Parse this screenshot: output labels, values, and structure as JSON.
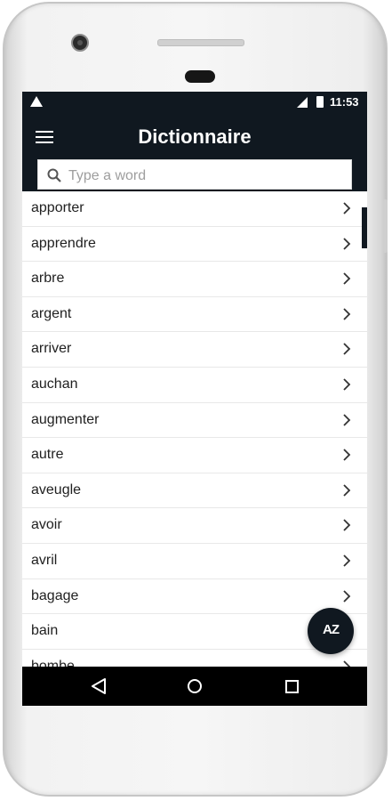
{
  "status_bar": {
    "time": "11:53"
  },
  "app_bar": {
    "title": "Dictionnaire"
  },
  "search": {
    "placeholder": "Type a word",
    "value": ""
  },
  "words": [
    "apporter",
    "apprendre",
    "arbre",
    "argent",
    "arriver",
    "auchan",
    "augmenter",
    "autre",
    "aveugle",
    "avoir",
    "avril",
    "bagage",
    "bain",
    "bombe"
  ],
  "fab": {
    "label": "AZ"
  },
  "colors": {
    "primary": "#101820",
    "background": "#ffffff",
    "divider": "#e8e8e8"
  },
  "icons": [
    "warning-icon",
    "signal-icon",
    "battery-icon",
    "menu-icon",
    "search-icon",
    "chevron-right-icon",
    "sort-az-icon",
    "back-icon",
    "home-icon",
    "recents-icon"
  ]
}
